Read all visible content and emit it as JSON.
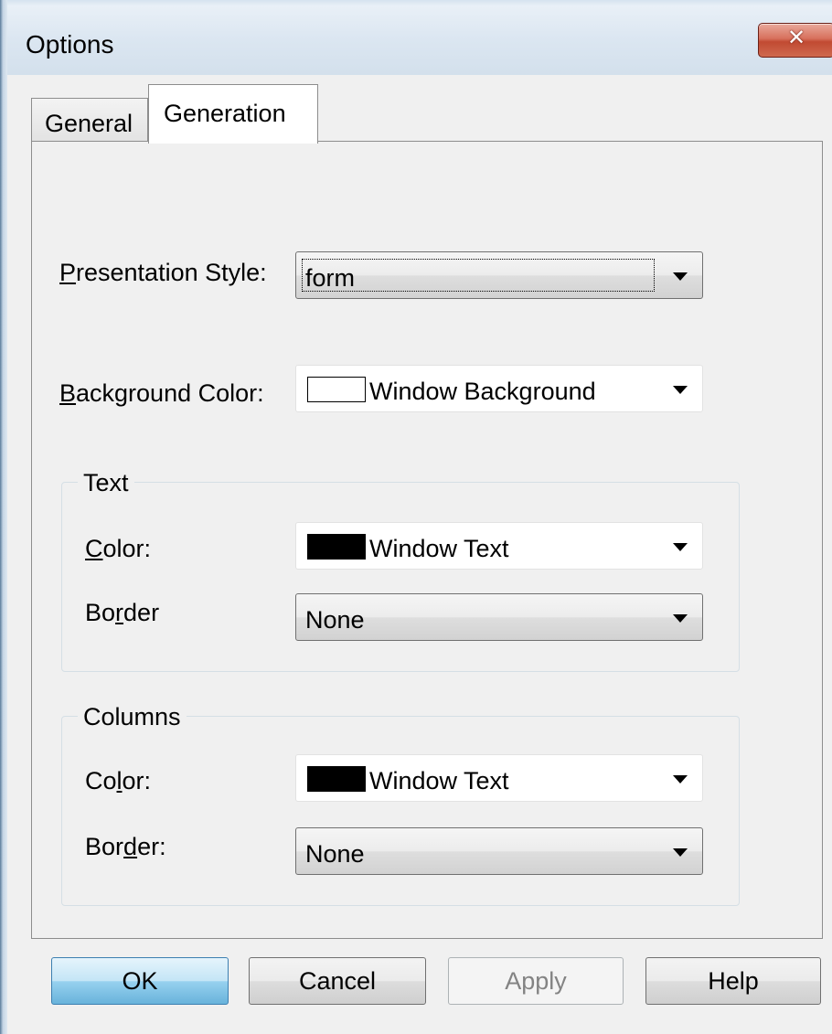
{
  "window": {
    "title": "Options",
    "close_symbol": "✕",
    "close_icon": "close-icon"
  },
  "tabs": [
    {
      "label": "General",
      "selected": false
    },
    {
      "label": "Generation",
      "selected": true
    }
  ],
  "presentation_style": {
    "label_mnemonic": "P",
    "label_rest": "resentation Style:",
    "value": "form"
  },
  "background_color": {
    "label_mnemonic": "B",
    "label_rest": "ackground Color:",
    "value": "Window Background",
    "swatch": "#ffffff"
  },
  "text_group": {
    "title": "Text",
    "color_label_mnemonic": "C",
    "color_label_rest": "olor:",
    "color_value": "Window Text",
    "color_swatch": "#000000",
    "border_label_pre": "Bo",
    "border_label_mnemonic": "r",
    "border_label_post": "der",
    "border_value": "None"
  },
  "columns_group": {
    "title": "Columns",
    "color_label_pre": "Co",
    "color_label_mnemonic": "l",
    "color_label_post": "or:",
    "color_value": "Window Text",
    "color_swatch": "#000000",
    "border_label_pre": "Bor",
    "border_label_mnemonic": "d",
    "border_label_post": "er:",
    "border_value": "None"
  },
  "buttons": {
    "ok": "OK",
    "cancel": "Cancel",
    "apply": "Apply",
    "help": "Help"
  }
}
